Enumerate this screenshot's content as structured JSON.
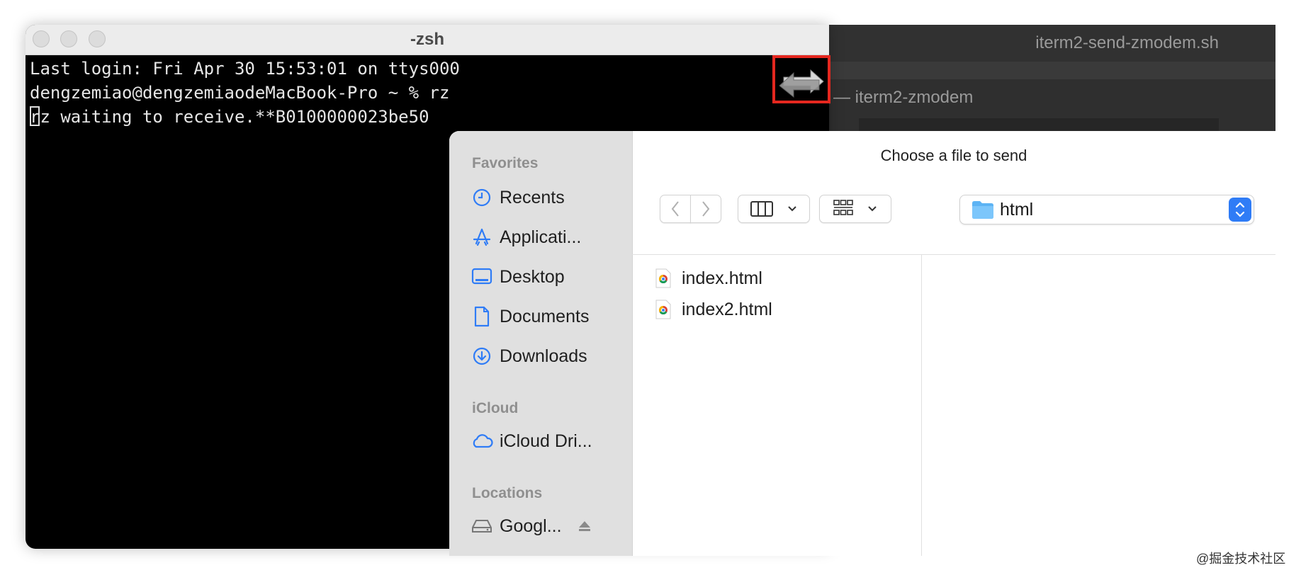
{
  "background_windows": {
    "editor_title": "iterm2-send-zmodem.sh",
    "second_title": "— iterm2-zmodem"
  },
  "terminal": {
    "title": "-zsh",
    "lines": [
      "Last login: Fri Apr 30 15:53:01 on ttys000",
      "dengzemiao@dengzemiaodeMacBook-Pro ~ % rz",
      "rz waiting to receive.**B0100000023be50"
    ]
  },
  "dialog": {
    "title": "Choose a file to send",
    "location": "html",
    "sidebar": {
      "favorites_header": "Favorites",
      "favorites": [
        {
          "label": "Recents",
          "icon": "clock-icon"
        },
        {
          "label": "Applicati...",
          "icon": "applications-icon"
        },
        {
          "label": "Desktop",
          "icon": "desktop-icon"
        },
        {
          "label": "Documents",
          "icon": "document-icon"
        },
        {
          "label": "Downloads",
          "icon": "download-icon"
        }
      ],
      "icloud_header": "iCloud",
      "icloud": [
        {
          "label": "iCloud Dri...",
          "icon": "cloud-icon"
        }
      ],
      "locations_header": "Locations",
      "locations": [
        {
          "label": "Googl...",
          "icon": "drive-icon"
        }
      ]
    },
    "files": [
      {
        "name": "index.html",
        "icon": "chrome-html-icon"
      },
      {
        "name": "index2.html",
        "icon": "chrome-html-icon"
      }
    ]
  },
  "watermark": "@掘金技术社区",
  "colors": {
    "accent": "#2f7cf6",
    "highlight_box": "#e5271f",
    "terminal_bg": "#000000",
    "sidebar_bg": "#e0e0e0"
  }
}
